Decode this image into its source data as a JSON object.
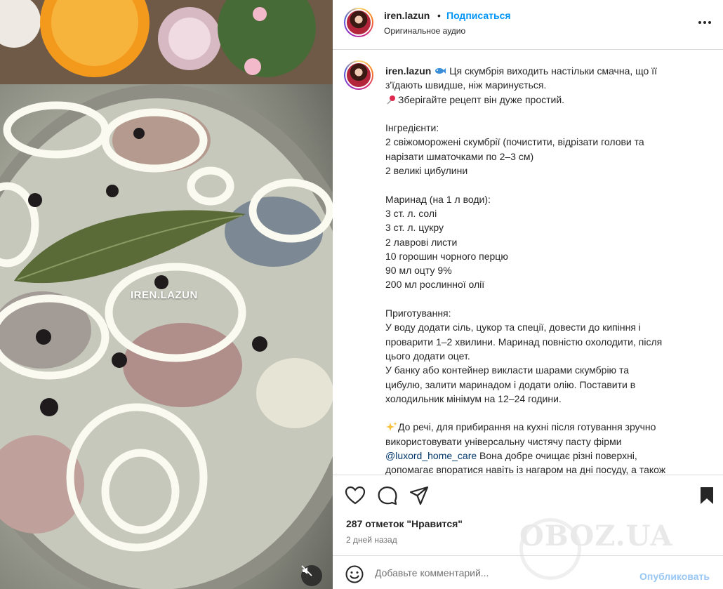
{
  "media": {
    "watermark": "IREN.LAZUN",
    "mute_icon": "speaker-muted-icon"
  },
  "header": {
    "username": "iren.lazun",
    "separator": "•",
    "follow_label": "Подписаться",
    "audio_label": "Оригинальное аудио",
    "more_icon": "more-horizontal-icon"
  },
  "caption": {
    "username": "iren.lazun",
    "lines": [
      " Ця скумбрія виходить настільки смачна, що її",
      "з'їдають швидше, ніж маринується.",
      "Зберігайте рецепт він дуже простий.",
      "",
      "Інгредієнти:",
      "2 свіжоморожені скумбрії (почистити, відрізати голови та",
      "нарізати шматочками по 2–3 см)",
      "2 великі цибулини",
      "",
      "Маринад (на 1 л води):",
      "3 ст. л. солі",
      "3 ст. л. цукру",
      "2 лаврові листи",
      "10 горошин чорного перцю",
      "90 мл оцту 9%",
      "200 мл рослинної олії",
      "",
      "Приготування:",
      "У воду додати сіль, цукор та спеції, довести до кипіння і",
      "проварити 1–2 хвилини. Маринад повністю охолодити, після",
      "цього додати оцет.",
      "У банку або контейнер викласти шарами скумбрію та",
      "цибулю, залити маринадом і додати олію. Поставити в",
      "холодильник мінімум на 12–24 години.",
      "",
      "До речі, для прибирання на кухні після готування зручно",
      "використовувати універсальну чистячу пасту фірми",
      "@luxord_home_care",
      " Вона добре очищає різні поверхні,",
      "допомагає впоратися навіть із нагаром на дні посуду, а також"
    ]
  },
  "actions": {
    "like_icon": "heart-icon",
    "comment_icon": "comment-icon",
    "share_icon": "share-icon",
    "save_icon": "bookmark-icon",
    "likes": "287 отметок \"Нравится\"",
    "time": "2 дней назад"
  },
  "comment": {
    "emoji_icon": "emoji-icon",
    "placeholder": "Добавьте комментарий...",
    "publish_label": "Опубликовать"
  },
  "brand_watermark": "OBOZ.UA",
  "colors": {
    "link": "#0095f6",
    "mention": "#00376b",
    "publish_disabled": "#99c7f5",
    "text": "#262626",
    "muted": "#737373",
    "border": "#dbdbdb"
  }
}
